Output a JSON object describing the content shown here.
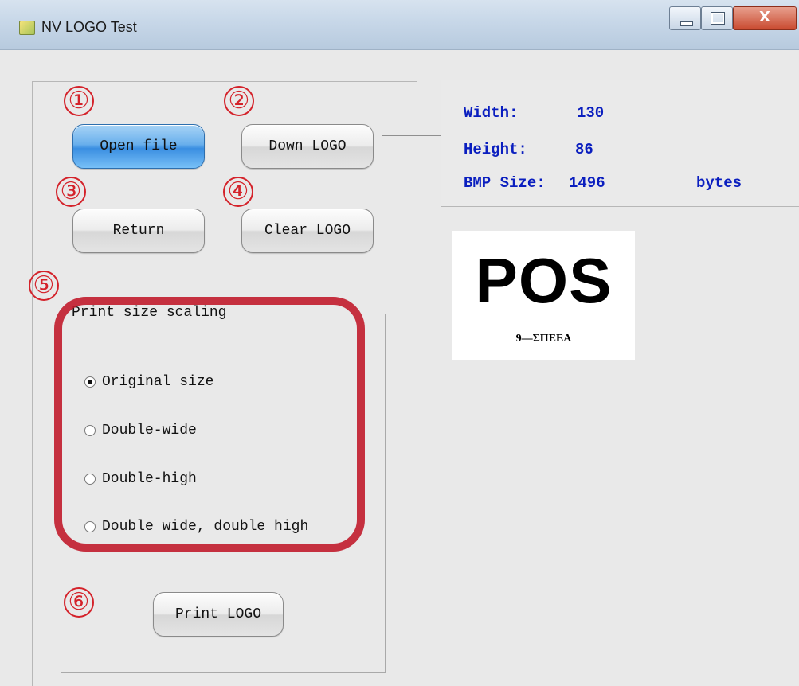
{
  "window": {
    "title": "NV LOGO Test",
    "app_icon": "app-icon",
    "controls": {
      "minimize_icon": "minimize-icon",
      "maximize_icon": "maximize-icon",
      "close_glyph": "X"
    }
  },
  "markers": [
    "①",
    "②",
    "③",
    "④",
    "⑤",
    "⑥"
  ],
  "buttons": {
    "open_file": "Open file",
    "down_logo": "Down LOGO",
    "return": "Return",
    "clear_logo": "Clear LOGO",
    "print_logo": "Print LOGO"
  },
  "info": {
    "width_label": "Width:",
    "width_value": "130",
    "height_label": "Height:",
    "height_value": "86",
    "size_label": "BMP Size:",
    "size_value": "1496",
    "size_unit": "bytes"
  },
  "print_scaling": {
    "caption": "Print size scaling",
    "options": [
      {
        "label": "Original size",
        "checked": true
      },
      {
        "label": "Double-wide",
        "checked": false
      },
      {
        "label": "Double-high",
        "checked": false
      },
      {
        "label": "Double wide, double high",
        "checked": false
      }
    ]
  },
  "logo_preview": {
    "main_text": "POS",
    "sub_text": "9—ΣΠΕΕΑ"
  },
  "colors": {
    "accent_blue": "#0a1ebf",
    "marker_red": "#d4222a",
    "button_blue": "#3a8ee1"
  }
}
